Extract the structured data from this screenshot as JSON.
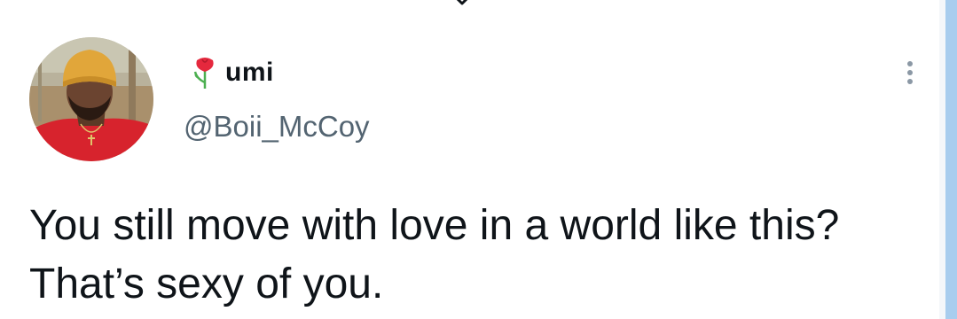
{
  "tweet": {
    "author": {
      "display_name": "umi",
      "handle": "@Boii_McCoy",
      "name_emoji": "flower-icon",
      "avatar": "avatar"
    },
    "text": "You still move with love in a world like this? That’s sexy of you."
  },
  "icons": {
    "more": "more-options-icon",
    "top": "chevron-down-icon"
  },
  "colors": {
    "text": "#0f1419",
    "secondary": "#536471",
    "accent_bar": "#a8cdee"
  }
}
